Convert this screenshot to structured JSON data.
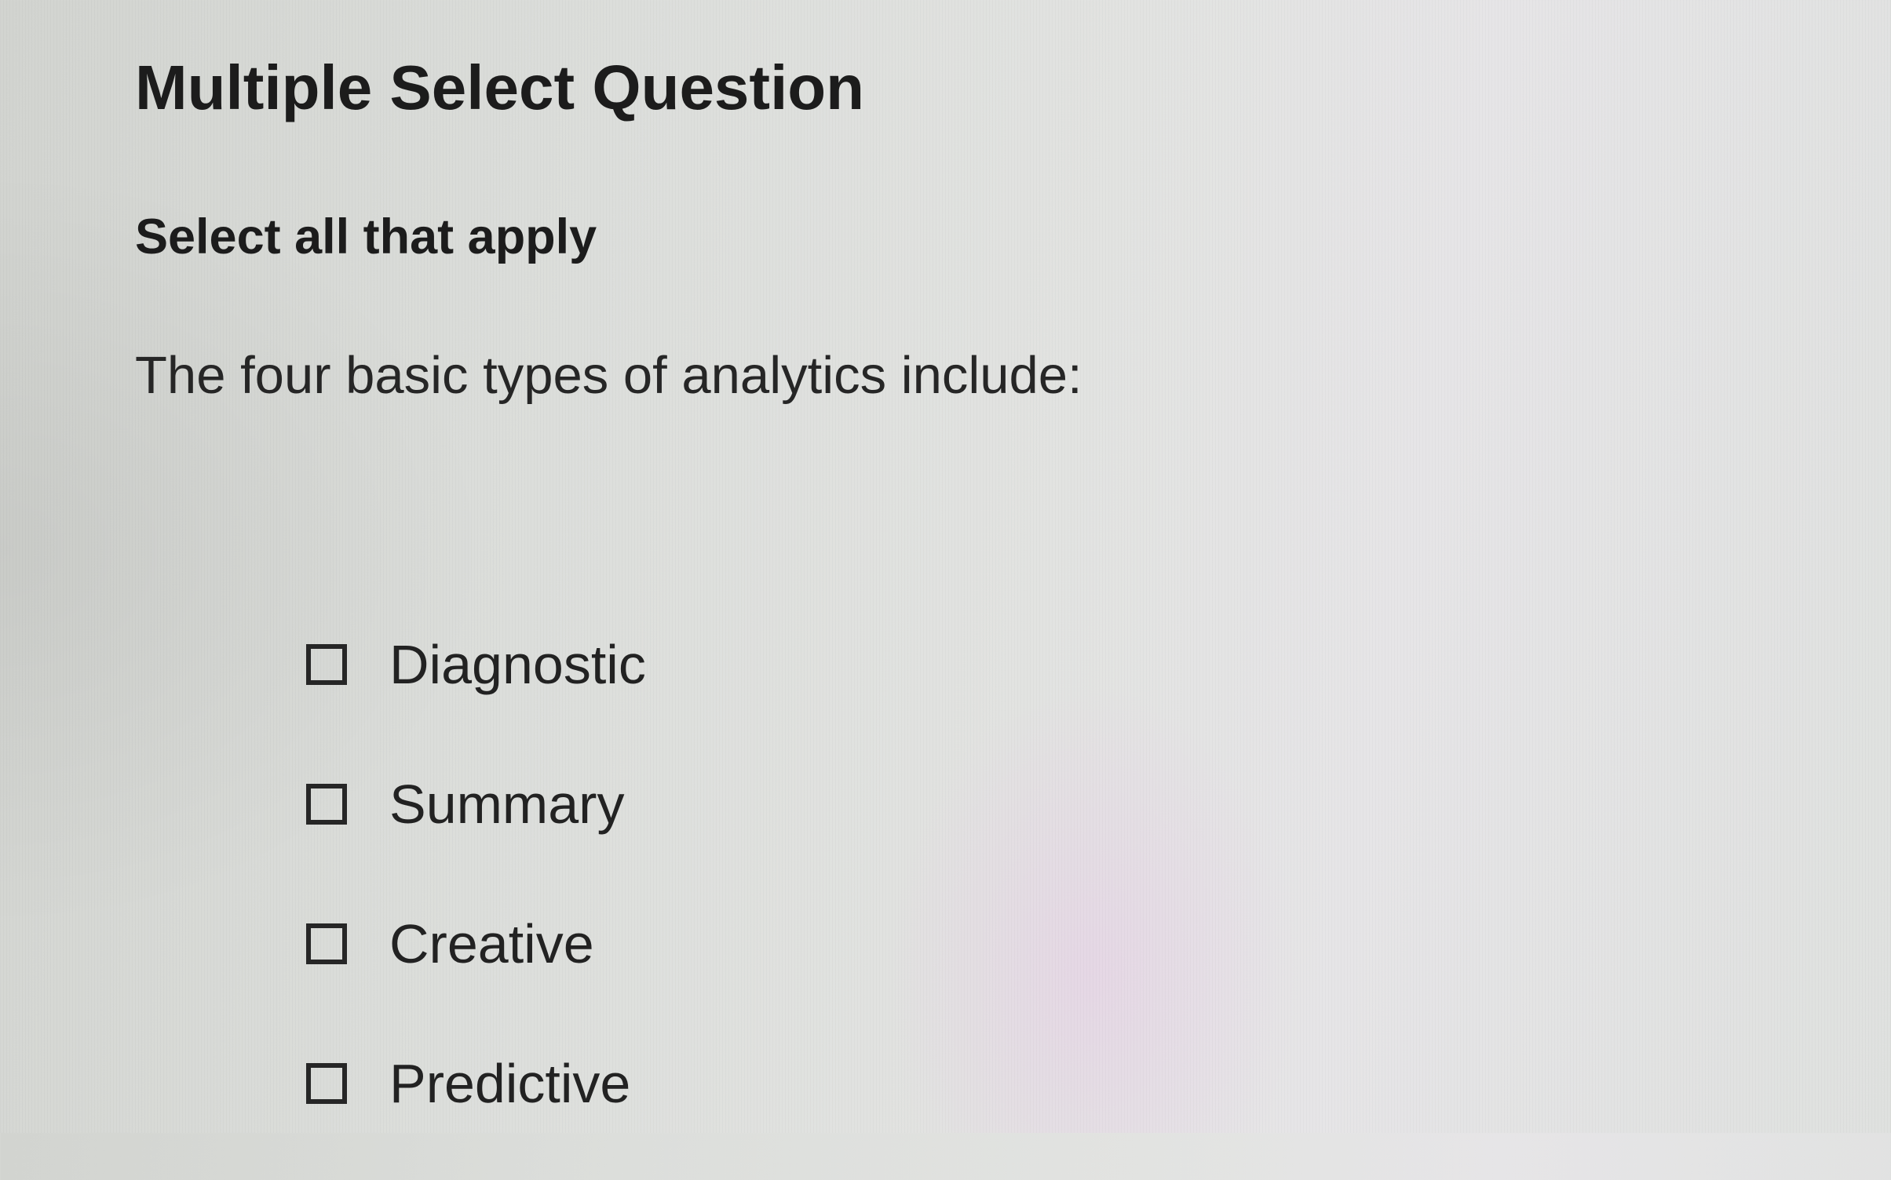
{
  "question": {
    "type_label": "Multiple Select Question",
    "instruction": "Select all that apply",
    "prompt": "The four basic types of analytics include:",
    "options": [
      {
        "label": "Diagnostic",
        "checked": false
      },
      {
        "label": "Summary",
        "checked": false
      },
      {
        "label": "Creative",
        "checked": false
      },
      {
        "label": "Predictive",
        "checked": false
      }
    ]
  }
}
